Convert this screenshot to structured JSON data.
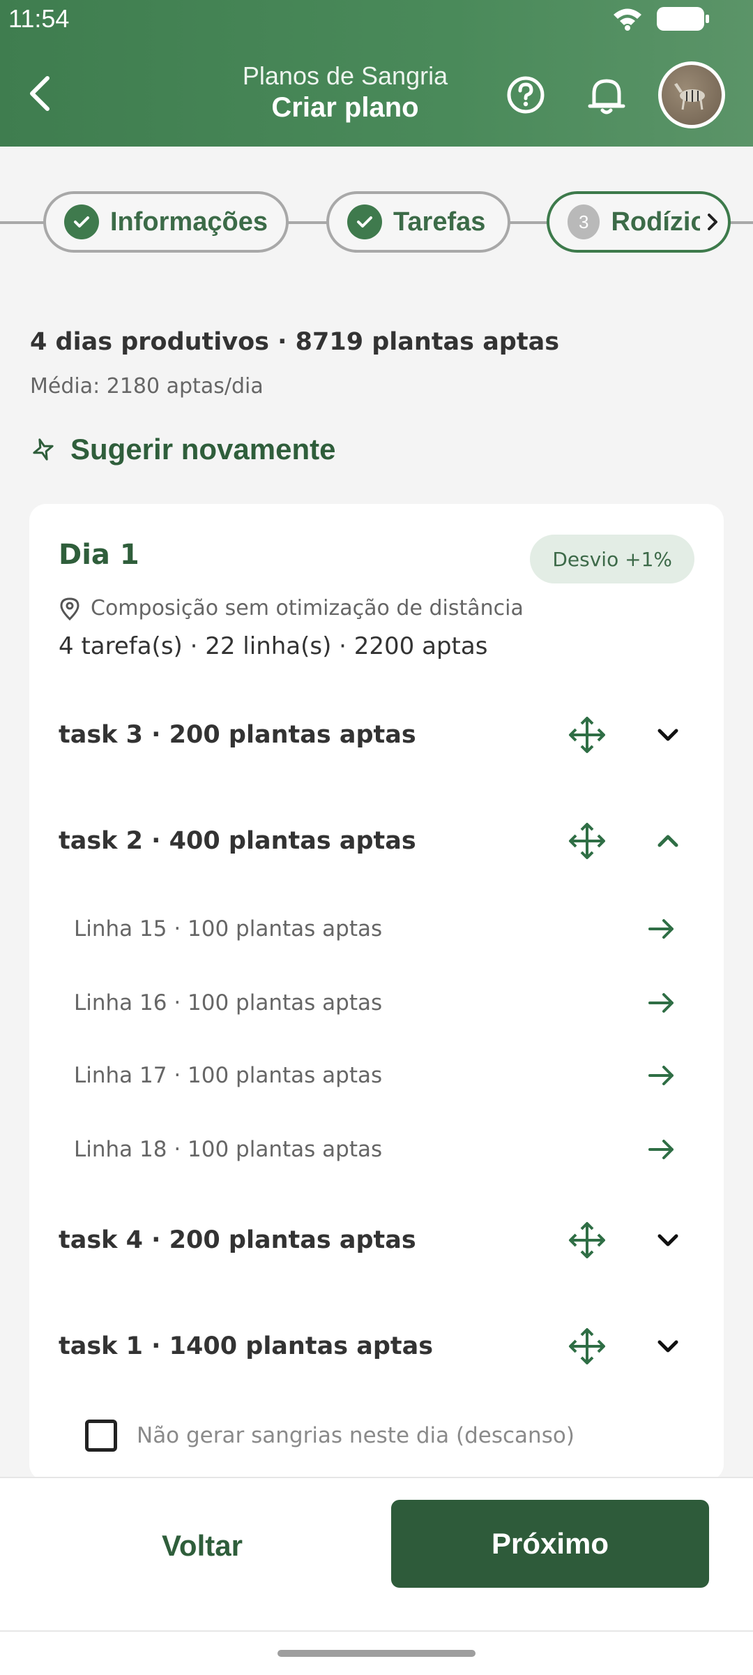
{
  "status": {
    "time": "11:54"
  },
  "header": {
    "subtitle": "Planos de Sangria",
    "title": "Criar plano"
  },
  "stepper": {
    "steps": [
      {
        "label": "Informações",
        "state": "done"
      },
      {
        "label": "Tarefas",
        "state": "done"
      },
      {
        "number": "3",
        "label": "Rodízio",
        "state": "active"
      }
    ]
  },
  "summary": {
    "headline": "4 dias produtivos · 8719 plantas aptas",
    "average": "Média: 2180 aptas/dia",
    "suggest_label": "Sugerir novamente"
  },
  "day": {
    "title": "Dia 1",
    "badge": "Desvio +1%",
    "composition": "Composição sem otimização de distância",
    "counts": "4 tarefa(s) · 22 linha(s) · 2200 aptas",
    "tasks": [
      {
        "label": "task 3 · 200 plantas aptas",
        "expanded": false
      },
      {
        "label": "task 2 · 400 plantas aptas",
        "expanded": true,
        "lines": [
          "Linha 15 · 100 plantas aptas",
          "Linha 16 · 100 plantas aptas",
          "Linha 17 · 100 plantas aptas",
          "Linha 18 · 100 plantas aptas"
        ]
      },
      {
        "label": "task 4 · 200 plantas aptas",
        "expanded": false
      },
      {
        "label": "task 1 · 1400 plantas aptas",
        "expanded": false
      }
    ],
    "rest_label": "Não gerar sangrias neste dia (descanso)"
  },
  "footer": {
    "back_label": "Voltar",
    "next_label": "Próximo"
  },
  "colors": {
    "primary": "#2e5b3a",
    "accent": "#3f7d4f"
  }
}
